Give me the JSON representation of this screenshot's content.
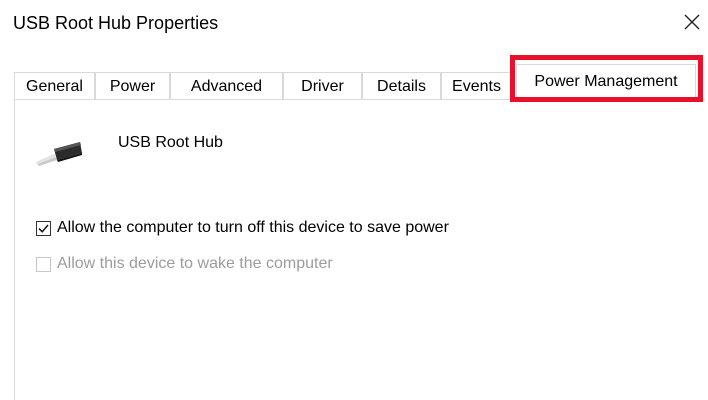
{
  "window": {
    "title": "USB Root Hub Properties",
    "close_icon": "close-icon"
  },
  "tabs": [
    {
      "label": "General"
    },
    {
      "label": "Power"
    },
    {
      "label": "Advanced"
    },
    {
      "label": "Driver"
    },
    {
      "label": "Details"
    },
    {
      "label": "Events"
    },
    {
      "label": "Power Management",
      "selected": true
    }
  ],
  "highlight_color": "#e8102a",
  "device": {
    "icon": "usb-plug-icon",
    "name": "USB Root Hub"
  },
  "options": [
    {
      "label": "Allow the computer to turn off this device to save power",
      "checked": true,
      "enabled": true
    },
    {
      "label": "Allow this device to wake the computer",
      "checked": false,
      "enabled": false
    }
  ]
}
